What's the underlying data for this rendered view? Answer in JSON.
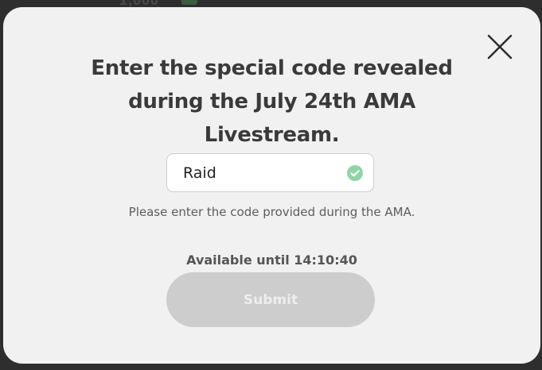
{
  "background": {
    "ghost_text": "1,000"
  },
  "modal": {
    "heading": "Enter the special code revealed during the July 24th AMA Livestream.",
    "close_icon": "close-x-icon",
    "code_input": {
      "value": "Raid",
      "placeholder": "",
      "valid_icon": "check-circle-icon",
      "valid_color": "#8fd4a6"
    },
    "helper_text": "Please enter the code provided during the AMA.",
    "availability_text": "Available until 14:10:40",
    "submit_label": "Submit",
    "submit_disabled": true
  },
  "colors": {
    "modal_background": "#f1f1f1",
    "heading": "#3a3a3a",
    "button_disabled": "#cdcdcd",
    "button_text": "#eeeeee"
  }
}
